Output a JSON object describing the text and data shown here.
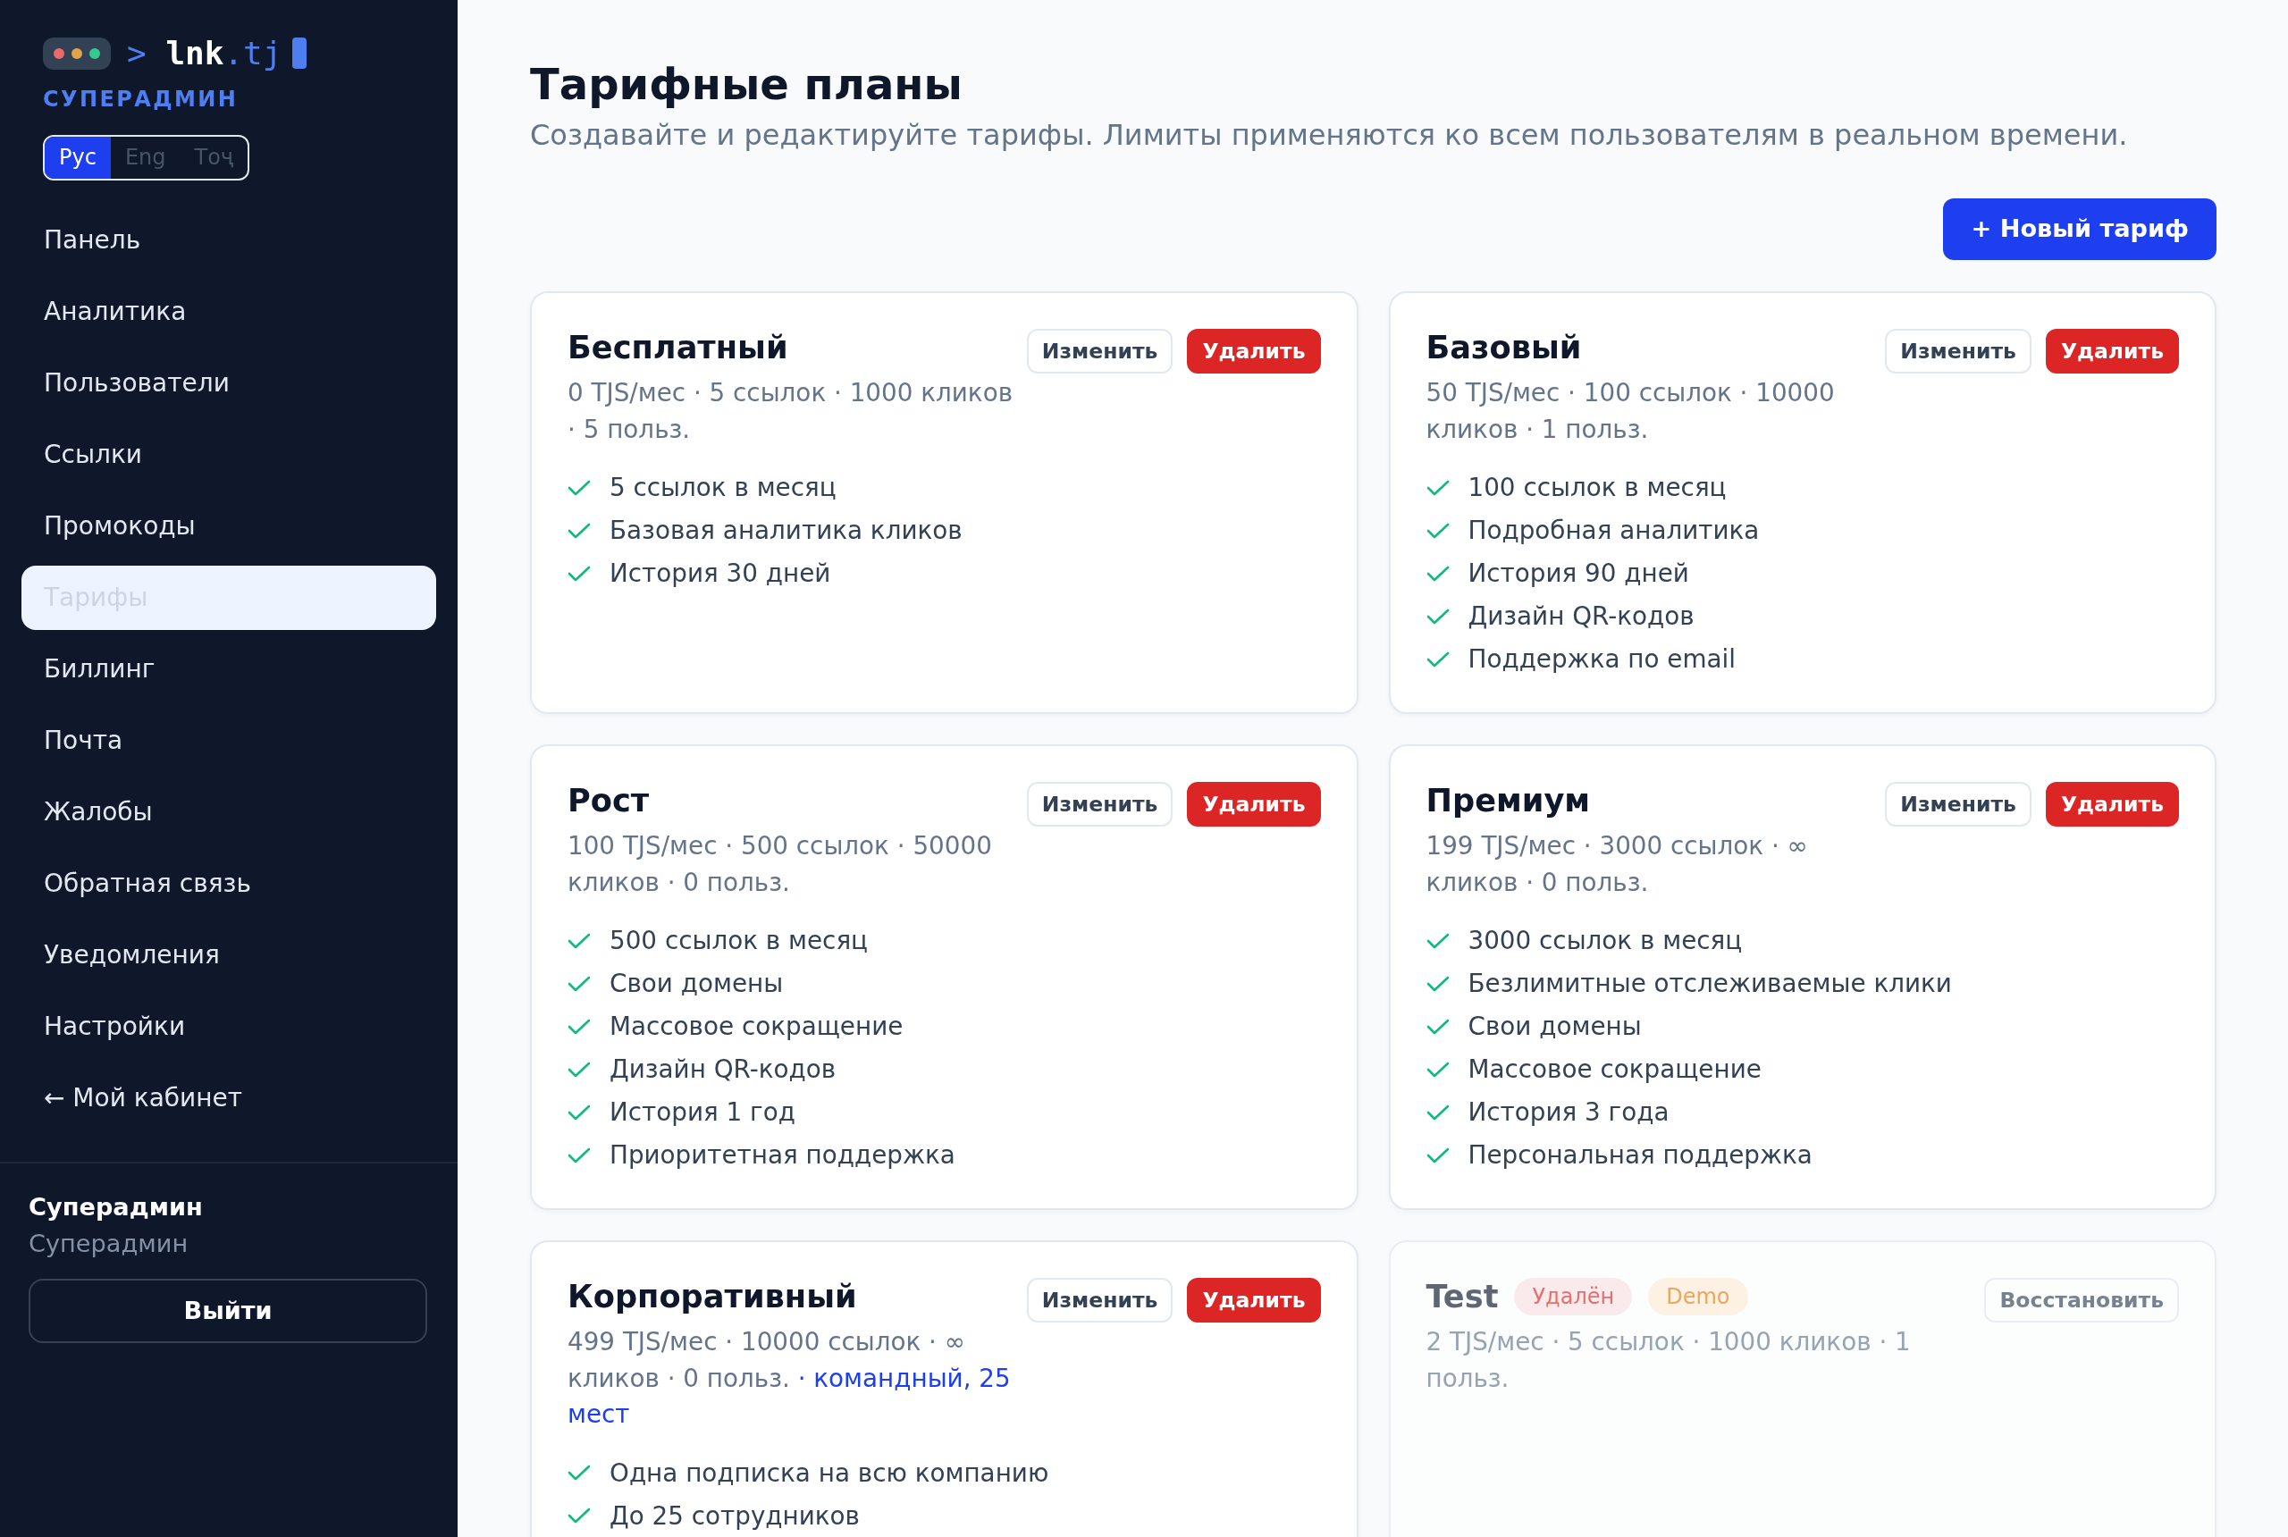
{
  "sidebar": {
    "logo": {
      "prompt": ">",
      "name": "lnk",
      "suffix": ".tj"
    },
    "role": "СУПЕРАДМИН",
    "languages": [
      {
        "label": "Рус",
        "selected": true
      },
      {
        "label": "Eng",
        "selected": false
      },
      {
        "label": "Тоҷ",
        "selected": false
      }
    ],
    "items": [
      {
        "label": "Панель",
        "selected": false
      },
      {
        "label": "Аналитика",
        "selected": false
      },
      {
        "label": "Пользователи",
        "selected": false
      },
      {
        "label": "Ссылки",
        "selected": false
      },
      {
        "label": "Промокоды",
        "selected": false
      },
      {
        "label": "Тарифы",
        "selected": true
      },
      {
        "label": "Биллинг",
        "selected": false
      },
      {
        "label": "Почта",
        "selected": false
      },
      {
        "label": "Жалобы",
        "selected": false
      },
      {
        "label": "Обратная связь",
        "selected": false
      },
      {
        "label": "Уведомления",
        "selected": false
      },
      {
        "label": "Настройки",
        "selected": false
      },
      {
        "label": "← Мой кабинет",
        "selected": false
      }
    ],
    "user": {
      "name": "Суперадмин",
      "role": "Суперадмин"
    },
    "logout_button": "Выйти"
  },
  "page": {
    "title": "Тарифные планы",
    "subtitle": "Создавайте и редактируйте тарифы. Лимиты применяются ко всем пользователям в реальном времени.",
    "new_plan_button": "+ Новый тариф"
  },
  "plans": [
    {
      "name": "Бесплатный",
      "deleted": false,
      "meta": "0 TJS/мес · 5 ссылок · 1000 кликов · 5 польз.",
      "actions": [
        {
          "label": "Изменить",
          "kind": "edit"
        },
        {
          "label": "Удалить",
          "kind": "delete"
        }
      ],
      "features": [
        "5 ссылок в месяц",
        "Базовая аналитика кликов",
        "История 30 дней"
      ]
    },
    {
      "name": "Базовый",
      "deleted": false,
      "meta": "50 TJS/мес · 100 ссылок · 10000 кликов · 1 польз.",
      "actions": [
        {
          "label": "Изменить",
          "kind": "edit"
        },
        {
          "label": "Удалить",
          "kind": "delete"
        }
      ],
      "features": [
        "100 ссылок в месяц",
        "Подробная аналитика",
        "История 90 дней",
        "Дизайн QR-кодов",
        "Поддержка по email"
      ]
    },
    {
      "name": "Рост",
      "deleted": false,
      "meta": "100 TJS/мес · 500 ссылок · 50000 кликов · 0 польз.",
      "actions": [
        {
          "label": "Изменить",
          "kind": "edit"
        },
        {
          "label": "Удалить",
          "kind": "delete"
        }
      ],
      "features": [
        "500 ссылок в месяц",
        "Свои домены",
        "Массовое сокращение",
        "Дизайн QR-кодов",
        "История 1 год",
        "Приоритетная поддержка"
      ]
    },
    {
      "name": "Премиум",
      "deleted": false,
      "meta": "199 TJS/мес · 3000 ссылок · ∞ кликов · 0 польз.",
      "actions": [
        {
          "label": "Изменить",
          "kind": "edit"
        },
        {
          "label": "Удалить",
          "kind": "delete"
        }
      ],
      "features": [
        "3000 ссылок в месяц",
        "Безлимитные отслеживаемые клики",
        "Свои домены",
        "Массовое сокращение",
        "История 3 года",
        "Персональная поддержка"
      ]
    },
    {
      "name": "Корпоративный",
      "deleted": false,
      "meta": "499 TJS/мес · 10000 ссылок · ∞ кликов · 0 польз.",
      "team_note": "· командный, 25 мест",
      "actions": [
        {
          "label": "Изменить",
          "kind": "edit"
        },
        {
          "label": "Удалить",
          "kind": "delete"
        }
      ],
      "features": [
        "Одна подписка на всю компанию",
        "До 25 сотрудников"
      ]
    },
    {
      "name": "Test",
      "deleted": true,
      "tags": [
        {
          "label": "Удалён",
          "kind": "deleted"
        },
        {
          "label": "Demo",
          "kind": "demo"
        }
      ],
      "meta": "2 TJS/мес · 5 ссылок · 1000 кликов · 1 польз.",
      "actions": [
        {
          "label": "Восстановить",
          "kind": "restore"
        }
      ]
    }
  ]
}
